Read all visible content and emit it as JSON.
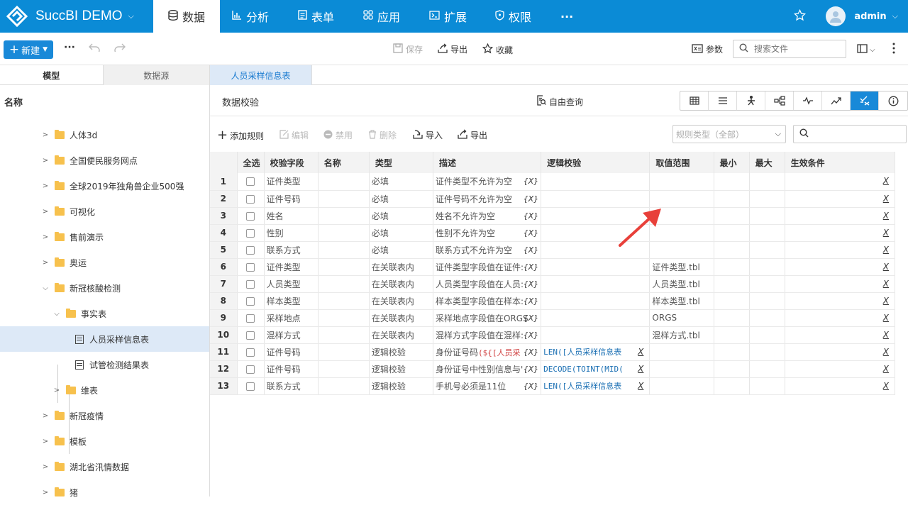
{
  "app": {
    "title": "SuccBI DEMO"
  },
  "nav": {
    "tabs": [
      {
        "label": "数据",
        "icon": "database-icon"
      },
      {
        "label": "分析",
        "icon": "bar-chart-icon"
      },
      {
        "label": "表单",
        "icon": "form-icon"
      },
      {
        "label": "应用",
        "icon": "apps-icon"
      },
      {
        "label": "扩展",
        "icon": "extension-icon"
      },
      {
        "label": "权限",
        "icon": "shield-icon"
      }
    ],
    "more": "···",
    "user": "admin"
  },
  "toolbar": {
    "new_label": "新建",
    "more": "···",
    "save_label": "保存",
    "export_label": "导出",
    "favorite_label": "收藏",
    "params_label": "参数",
    "search_placeholder": "搜索文件"
  },
  "sidebar": {
    "tab_model": "模型",
    "tab_datasource": "数据源",
    "header": "名称",
    "items": [
      {
        "label": "人体3d",
        "type": "folder"
      },
      {
        "label": "全国便民服务网点",
        "type": "folder"
      },
      {
        "label": "全球2019年独角兽企业500强",
        "type": "folder"
      },
      {
        "label": "可视化",
        "type": "folder"
      },
      {
        "label": "售前演示",
        "type": "folder"
      },
      {
        "label": "奥运",
        "type": "folder"
      },
      {
        "label": "新冠核酸检测",
        "type": "folder"
      },
      {
        "label": "事实表",
        "type": "folder"
      },
      {
        "label": "人员采样信息表",
        "type": "table"
      },
      {
        "label": "试管检测结果表",
        "type": "table"
      },
      {
        "label": "维表",
        "type": "folder"
      },
      {
        "label": "新冠疫情",
        "type": "folder"
      },
      {
        "label": "模板",
        "type": "folder"
      },
      {
        "label": "湖北省汛情数据",
        "type": "folder"
      },
      {
        "label": "猪",
        "type": "folder"
      }
    ]
  },
  "main": {
    "tab_label": "人员采样信息表",
    "title": "数据校验",
    "free_query": "自由查询",
    "actions": {
      "add": "添加规则",
      "edit": "编辑",
      "disable": "禁用",
      "delete": "删除",
      "import": "导入",
      "export": "导出"
    },
    "rule_type_select": "规则类型（全部）",
    "columns": [
      "全选",
      "校验字段",
      "名称",
      "类型",
      "描述",
      "逻辑校验",
      "取值范围",
      "最小",
      "最大",
      "生效条件"
    ],
    "rows": [
      {
        "n": "1",
        "field": "证件类型",
        "name": "",
        "type": "必填",
        "desc": "证件类型不允许为空",
        "logic": "",
        "range": ""
      },
      {
        "n": "2",
        "field": "证件号码",
        "name": "",
        "type": "必填",
        "desc": "证件号码不允许为空",
        "logic": "",
        "range": ""
      },
      {
        "n": "3",
        "field": "姓名",
        "name": "",
        "type": "必填",
        "desc": "姓名不允许为空",
        "logic": "",
        "range": ""
      },
      {
        "n": "4",
        "field": "性别",
        "name": "",
        "type": "必填",
        "desc": "性别不允许为空",
        "logic": "",
        "range": ""
      },
      {
        "n": "5",
        "field": "联系方式",
        "name": "",
        "type": "必填",
        "desc": "联系方式不允许为空",
        "logic": "",
        "range": ""
      },
      {
        "n": "6",
        "field": "证件类型",
        "name": "",
        "type": "在关联表内",
        "desc": "证件类型字段值在证件:",
        "logic": "",
        "range": "证件类型.tbl"
      },
      {
        "n": "7",
        "field": "人员类型",
        "name": "",
        "type": "在关联表内",
        "desc": "人员类型字段值在人员:",
        "logic": "",
        "range": "人员类型.tbl"
      },
      {
        "n": "8",
        "field": "样本类型",
        "name": "",
        "type": "在关联表内",
        "desc": "样本类型字段值在样本:",
        "logic": "",
        "range": "样本类型.tbl"
      },
      {
        "n": "9",
        "field": "采样地点",
        "name": "",
        "type": "在关联表内",
        "desc": "采样地点字段值在ORGS",
        "logic": "",
        "range": "ORGS"
      },
      {
        "n": "10",
        "field": "混样方式",
        "name": "",
        "type": "在关联表内",
        "desc": "混样方式字段值在混样:",
        "logic": "",
        "range": "混样方式.tbl"
      },
      {
        "n": "11",
        "field": "证件号码",
        "name": "",
        "type": "逻辑校验",
        "desc": "身份证号码",
        "desc_code": "(${[人员采",
        "logic": "LEN([人员采样信息表",
        "range": ""
      },
      {
        "n": "12",
        "field": "证件号码",
        "name": "",
        "type": "逻辑校验",
        "desc": "身份证号中性别信息与'",
        "logic": "DECODE(TOINT(MID(",
        "range": ""
      },
      {
        "n": "13",
        "field": "联系方式",
        "name": "",
        "type": "逻辑校验",
        "desc": "手机号必须是11位",
        "logic": "LEN([人员采样信息表",
        "range": ""
      }
    ]
  },
  "colors": {
    "brand": "#0b8bd6",
    "accent": "#1989d8",
    "selected": "#dde9f7",
    "arrow": "#e8403a"
  }
}
